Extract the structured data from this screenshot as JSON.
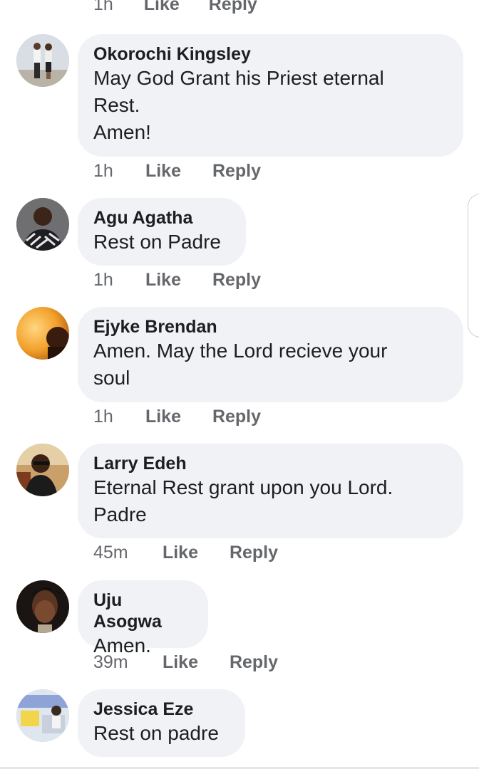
{
  "top_actions": {
    "time": "1h",
    "like": "Like",
    "reply": "Reply"
  },
  "comments": [
    {
      "author": "Okorochi Kingsley",
      "text": "May God Grant his Priest eternal\nRest.\nAmen!",
      "time": "1h",
      "like": "Like",
      "reply": "Reply"
    },
    {
      "author": "Agu Agatha",
      "text": "Rest on Padre",
      "time": "1h",
      "like": "Like",
      "reply": "Reply"
    },
    {
      "author": "Ejyke Brendan",
      "text": "Amen. May the Lord recieve your\nsoul",
      "time": "1h",
      "like": "Like",
      "reply": "Reply"
    },
    {
      "author": "Larry Edeh",
      "text": "Eternal Rest grant upon you Lord.\nPadre",
      "time": "45m",
      "like": "Like",
      "reply": "Reply"
    },
    {
      "author": "Uju Asogwa",
      "text": "Amen.",
      "time": "39m",
      "like": "Like",
      "reply": "Reply"
    },
    {
      "author": "Jessica Eze",
      "text": "Rest on padre"
    }
  ]
}
